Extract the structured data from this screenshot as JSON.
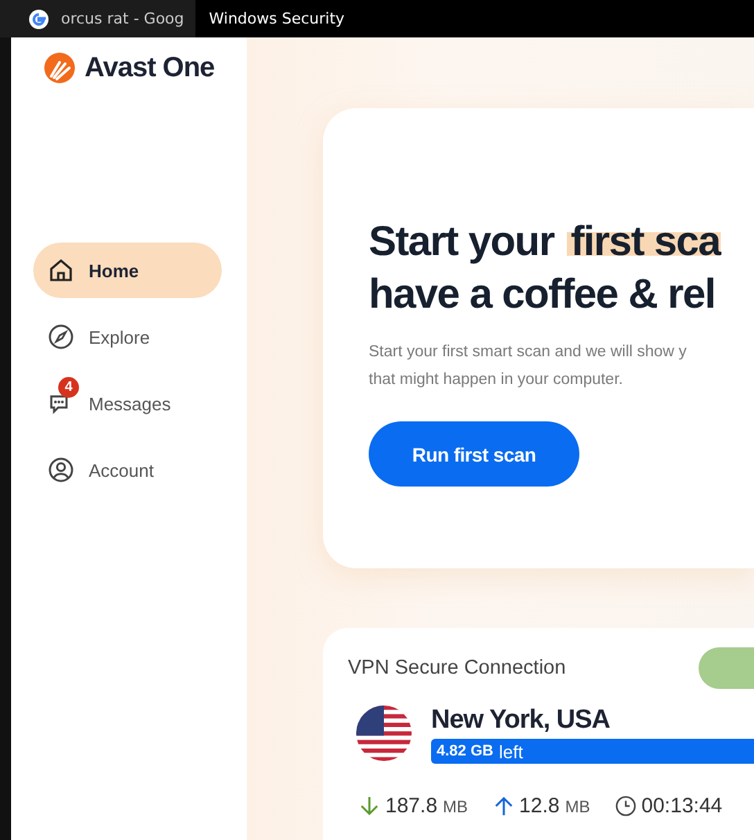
{
  "taskbar": {
    "tabs": [
      {
        "label": "orcus rat - Goog",
        "selected": false
      },
      {
        "label": "Windows Security",
        "selected": true
      }
    ]
  },
  "app": {
    "name": "Avast One"
  },
  "sidebar": {
    "items": [
      {
        "label": "Home",
        "kind": "home",
        "selected": true
      },
      {
        "label": "Explore",
        "kind": "explore",
        "selected": false
      },
      {
        "label": "Messages",
        "kind": "messages",
        "selected": false,
        "badge": "4"
      },
      {
        "label": "Account",
        "kind": "account",
        "selected": false
      }
    ]
  },
  "hero": {
    "title_start": "Start your",
    "title_highlight": "first sca",
    "title_line2": "have a coffee & rel",
    "description": [
      "Start your first smart scan and we will show y",
      "that might happen in your computer."
    ],
    "button": "Run first scan"
  },
  "vpn": {
    "title": "VPN Secure Connection",
    "on": true,
    "location": "New York, USA",
    "allowance": "4.82 GB",
    "allowance_suffix": "left",
    "stats": [
      {
        "kind": "download",
        "value": "187.8",
        "unit": "MB"
      },
      {
        "kind": "upload",
        "value": "12.8",
        "unit": "MB"
      },
      {
        "kind": "time",
        "value": "00:13:44"
      }
    ]
  }
}
